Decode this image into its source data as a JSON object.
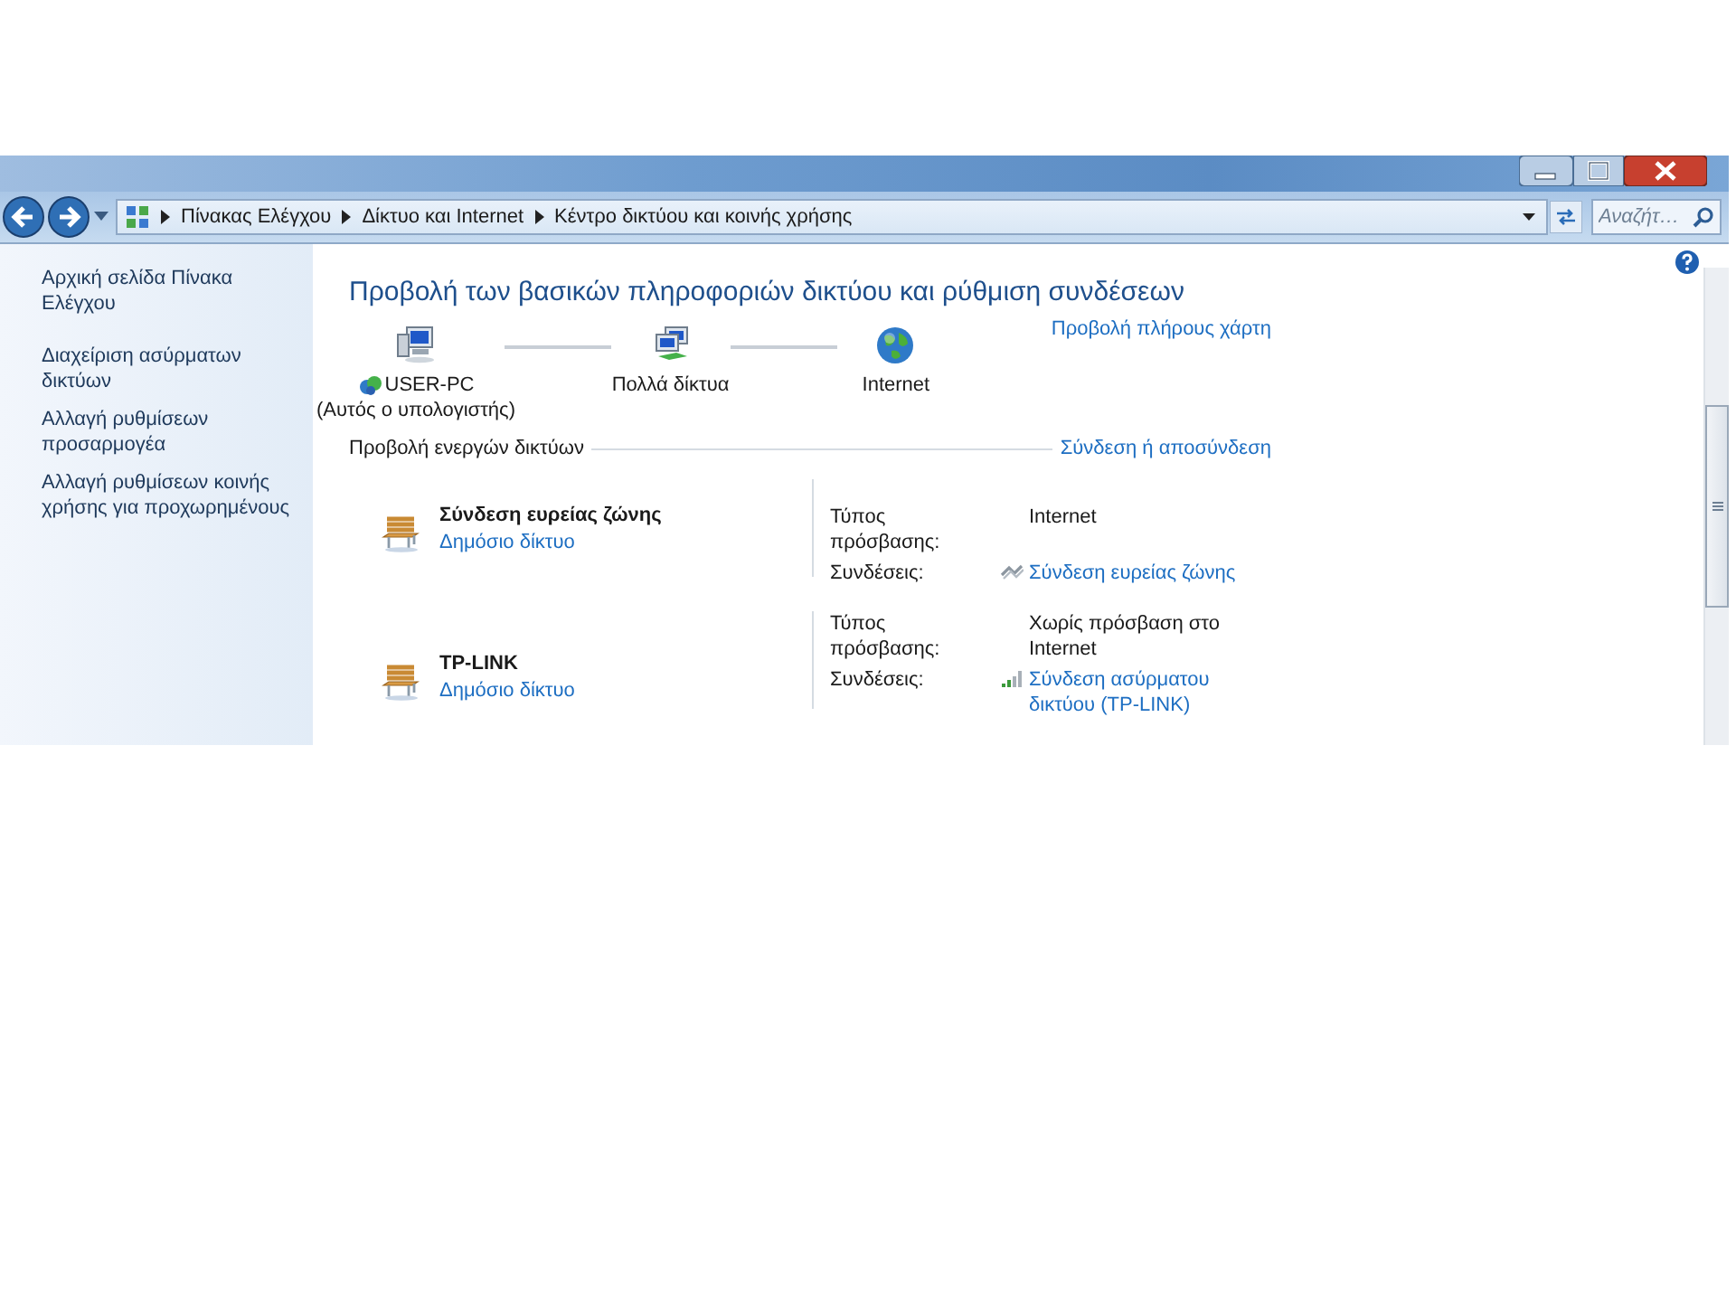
{
  "address_bar": {
    "path": [
      "Πίνακας Ελέγχου",
      "Δίκτυο και Internet",
      "Κέντρο δικτύου και κοινής χρήσης"
    ]
  },
  "search": {
    "placeholder": "Αναζήτ…"
  },
  "sidebar": {
    "items": [
      "Αρχική σελίδα Πίνακα Ελέγχου",
      "Διαχείριση ασύρματων δικτύων",
      "Αλλαγή ρυθμίσεων προσαρμογέα",
      "Αλλαγή ρυθμίσεων κοινής χρήσης για προχωρημένους"
    ]
  },
  "title": "Προβολή των βασικών πληροφοριών δικτύου και ρύθμιση συνδέσεων",
  "network_map": {
    "nodes": [
      {
        "kind": "computer",
        "label": "USER-PC",
        "sublabel": "(Αυτός ο υπολογιστής)"
      },
      {
        "kind": "networks",
        "label": "Πολλά δίκτυα"
      },
      {
        "kind": "globe",
        "label": "Internet"
      }
    ],
    "link": "Προβολή πλήρους χάρτη"
  },
  "active_networks": {
    "heading": "Προβολή ενεργών δικτύων",
    "link": "Σύνδεση ή αποσύνδεση",
    "networks": [
      {
        "name": "Σύνδεση ευρείας ζώνης",
        "category": "Δημόσιο δίκτυο",
        "access_label": "Τύπος πρόσβασης:",
        "access": "Internet",
        "connections_label": "Συνδέσεις:",
        "kind": "broadband",
        "connection": "Σύνδεση ευρείας ζώνης"
      },
      {
        "name": "TP-LINK",
        "category": "Δημόσιο δίκτυο",
        "access_label": "Τύπος πρόσβασης:",
        "access": "Χωρίς πρόσβαση στο Internet",
        "connections_label": "Συνδέσεις:",
        "kind": "wireless",
        "connection": "Σύνδεση ασύρματου δικτύου (TP-LINK)"
      }
    ]
  }
}
